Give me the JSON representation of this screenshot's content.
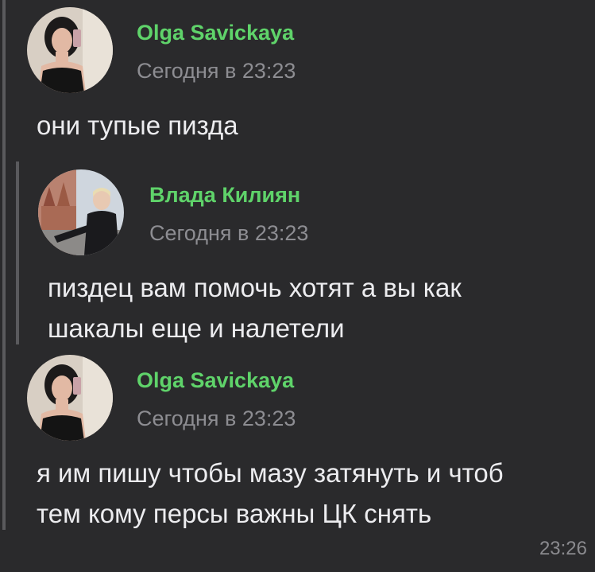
{
  "messages": [
    {
      "author": "Olga Savickaya",
      "timestamp": "Сегодня в 23:23",
      "lines": [
        "они тупые пизда"
      ]
    },
    {
      "author": "Влада Килиян",
      "timestamp": "Сегодня в 23:23",
      "lines": [
        "пиздец вам помочь хотят а вы как",
        "шакалы еще и налетели"
      ]
    },
    {
      "author": "Olga Savickaya",
      "timestamp": "Сегодня в 23:23",
      "lines": [
        "я им пишу чтобы мазу затянуть и чтоб",
        "тем кому персы важны ЦК снять"
      ]
    }
  ],
  "message_time": "23:26",
  "colors": {
    "background": "#2a2a2c",
    "author": "#5fd36a",
    "meta": "#8d8d92",
    "text": "#ececef",
    "thread_bar": "#5a5a5d"
  }
}
